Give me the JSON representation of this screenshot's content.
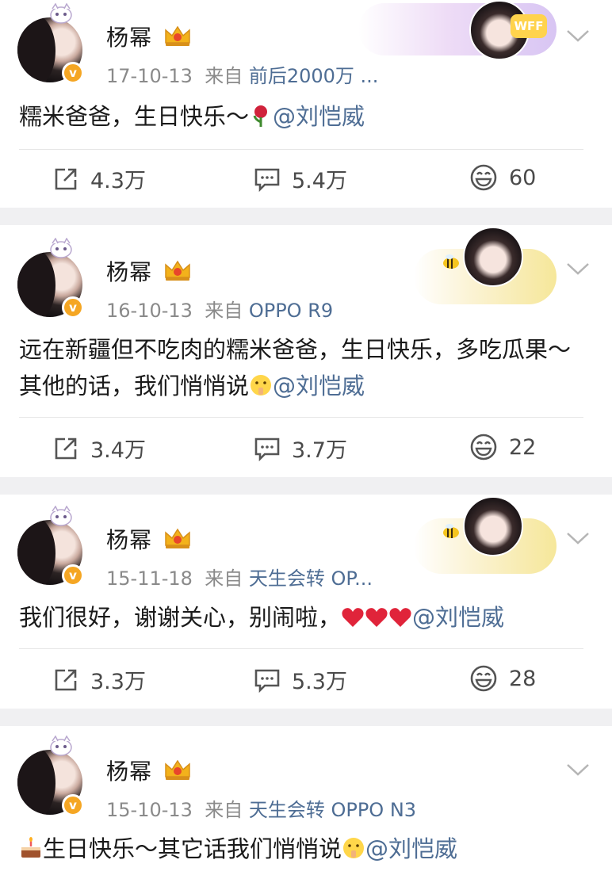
{
  "user": {
    "name": "杨幂"
  },
  "posts": [
    {
      "date": "17-10-13",
      "from_label": "来自",
      "source": "前后2000万 ...",
      "text": "糯米爸爸，生日快乐～",
      "emoji_names": [
        "rose-emoji"
      ],
      "mention": "@刘恺威",
      "repost_count": "4.3万",
      "comment_count": "5.4万",
      "like_count": "60",
      "card_badge_text": "WFF"
    },
    {
      "date": "16-10-13",
      "from_label": "来自",
      "source": "OPPO R9",
      "text": "远在新疆但不吃肉的糯米爸爸，生日快乐，多吃瓜果～其他的话，我们悄悄说",
      "emoji_names": [
        "hush-emoji"
      ],
      "mention": "@刘恺威",
      "repost_count": "3.4万",
      "comment_count": "3.7万",
      "like_count": "22"
    },
    {
      "date": "15-11-18",
      "from_label": "来自",
      "source": "天生会转 OP...",
      "text": "我们很好，谢谢关心，别闹啦，",
      "emoji_names": [
        "heart-emoji",
        "heart-emoji",
        "heart-emoji"
      ],
      "mention": "@刘恺威",
      "repost_count": "3.3万",
      "comment_count": "5.3万",
      "like_count": "28"
    },
    {
      "date": "15-10-13",
      "from_label": "来自",
      "source": "天生会转 OPPO N3",
      "text": "生日快乐～其它话我们悄悄说",
      "emoji_names": [
        "cake-emoji",
        "hush-emoji"
      ],
      "mention": "@刘恺威"
    }
  ],
  "colors": {
    "link": "#4e6d94",
    "meta": "#8a8a8a",
    "verified": "#f5a623",
    "crown": "#f3b21b",
    "heart": "#e0243a",
    "background": "#f0f0f2"
  },
  "icons": [
    "repost-icon",
    "comment-icon",
    "like-icon",
    "chevron-down-icon",
    "crown-icon",
    "verified-icon"
  ]
}
